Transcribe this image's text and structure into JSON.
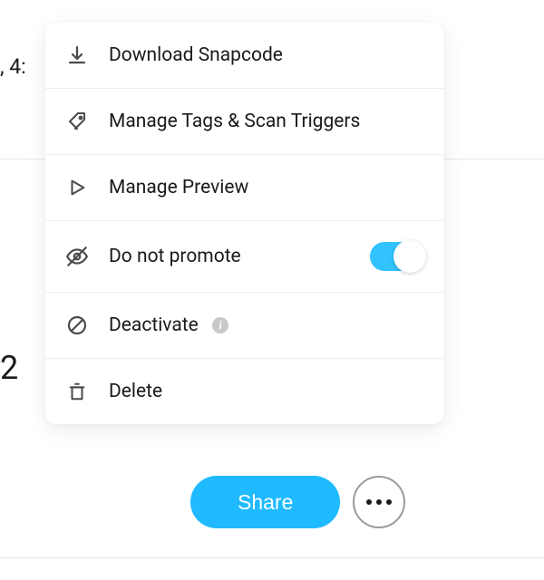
{
  "background": {
    "partial_text_1": ", 4:",
    "partial_text_2": "2"
  },
  "menu": {
    "items": [
      {
        "label": "Download Snapcode"
      },
      {
        "label": "Manage Tags & Scan Triggers"
      },
      {
        "label": "Manage Preview"
      },
      {
        "label": "Do not promote",
        "toggle": true
      },
      {
        "label": "Deactivate",
        "info": true
      },
      {
        "label": "Delete"
      }
    ]
  },
  "actions": {
    "share_label": "Share"
  }
}
